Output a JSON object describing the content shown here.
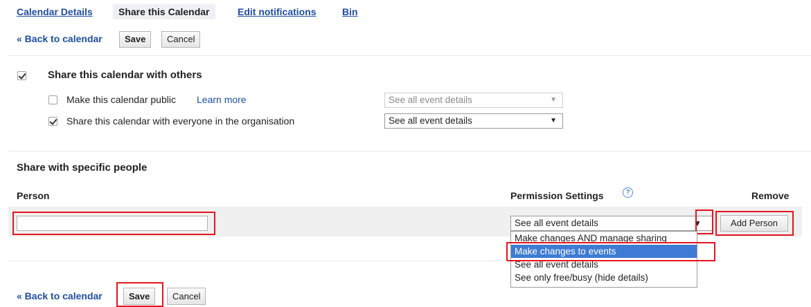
{
  "tabs": [
    {
      "label": "Calendar Details"
    },
    {
      "label": "Share this Calendar"
    },
    {
      "label": "Edit notifications"
    },
    {
      "label": "Bin"
    }
  ],
  "top_bar": {
    "back_link": "« Back to calendar",
    "save_label": "Save",
    "cancel_label": "Cancel"
  },
  "share_others": {
    "title": "Share this calendar with others",
    "checked": true,
    "public": {
      "label": "Make this calendar public",
      "learn_more": "Learn more",
      "checked": false,
      "select_value": "See all event details"
    },
    "organisation": {
      "label": "Share this calendar with everyone in the organisation",
      "checked": true,
      "select_value": "See all event details"
    }
  },
  "specific": {
    "title": "Share with specific people",
    "col_person": "Person",
    "col_permission": "Permission Settings",
    "col_remove": "Remove",
    "person_input_value": "",
    "permission_select_value": "See all event details",
    "add_person_label": "Add Person",
    "permission_options": [
      {
        "label": "Make changes AND manage sharing",
        "selected": false
      },
      {
        "label": "Make changes to events",
        "selected": true
      },
      {
        "label": "See all event details",
        "selected": false
      },
      {
        "label": "See only free/busy (hide details)",
        "selected": false
      }
    ]
  },
  "bottom_bar": {
    "back_link": "« Back to calendar",
    "save_label": "Save",
    "cancel_label": "Cancel"
  },
  "colors": {
    "link": "#1f4ea1",
    "highlight": "#e4141d",
    "selected_option": "#3d7bd4"
  },
  "icons": {
    "help": "question-circle-icon",
    "dropdown": "triangle-down-icon",
    "checkbox": "checkmark-icon"
  }
}
